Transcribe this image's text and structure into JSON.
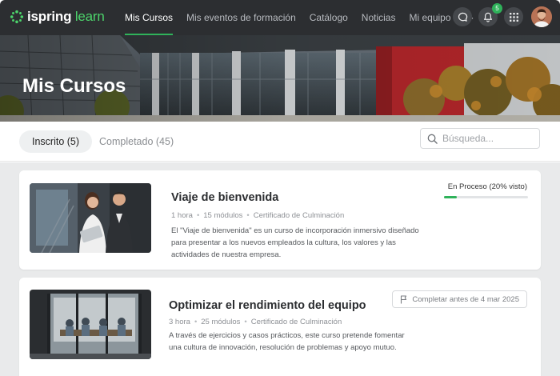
{
  "brand": {
    "name_part1": "ispring",
    "name_part2": "learn",
    "accent": "#2fb25a"
  },
  "nav": {
    "items": [
      {
        "label": "Mis Cursos",
        "active": true
      },
      {
        "label": "Mis eventos de formación",
        "active": false
      },
      {
        "label": "Catálogo",
        "active": false
      },
      {
        "label": "Noticias",
        "active": false
      },
      {
        "label": "Mi equipo",
        "active": false
      },
      {
        "label": "···",
        "active": false
      }
    ],
    "notifications_count": "5",
    "icons": [
      "chat-icon",
      "bell-icon",
      "apps-grid-icon",
      "avatar"
    ]
  },
  "hero": {
    "title": "Mis Cursos"
  },
  "tabs": [
    {
      "label": "Inscrito (5)",
      "active": true
    },
    {
      "label": "Completado (45)",
      "active": false
    }
  ],
  "search": {
    "placeholder": "Búsqueda..."
  },
  "courses": [
    {
      "title": "Viaje de bienvenida",
      "duration": "1 hora",
      "modules": "15 módulos",
      "certificate": "Certificado de Culminación",
      "description": "El \"Viaje de bienvenida\" es un curso de incorporación inmersivo diseñado para presentar a los nuevos empleados la cultura, los valores y las actividades de nuestra empresa.",
      "status": "En Proceso (20% visto)",
      "progress": 0.15
    },
    {
      "title": "Optimizar el rendimiento del equipo",
      "duration": "3 hora",
      "modules": "25 módulos",
      "certificate": "Certificado de Culminación",
      "description": "A través de ejercicios y casos prácticos, este curso pretende fomentar una cultura de innovación, resolución de problemas y apoyo mutuo.",
      "deadline": "Completar antes de 4 mar 2025"
    }
  ]
}
